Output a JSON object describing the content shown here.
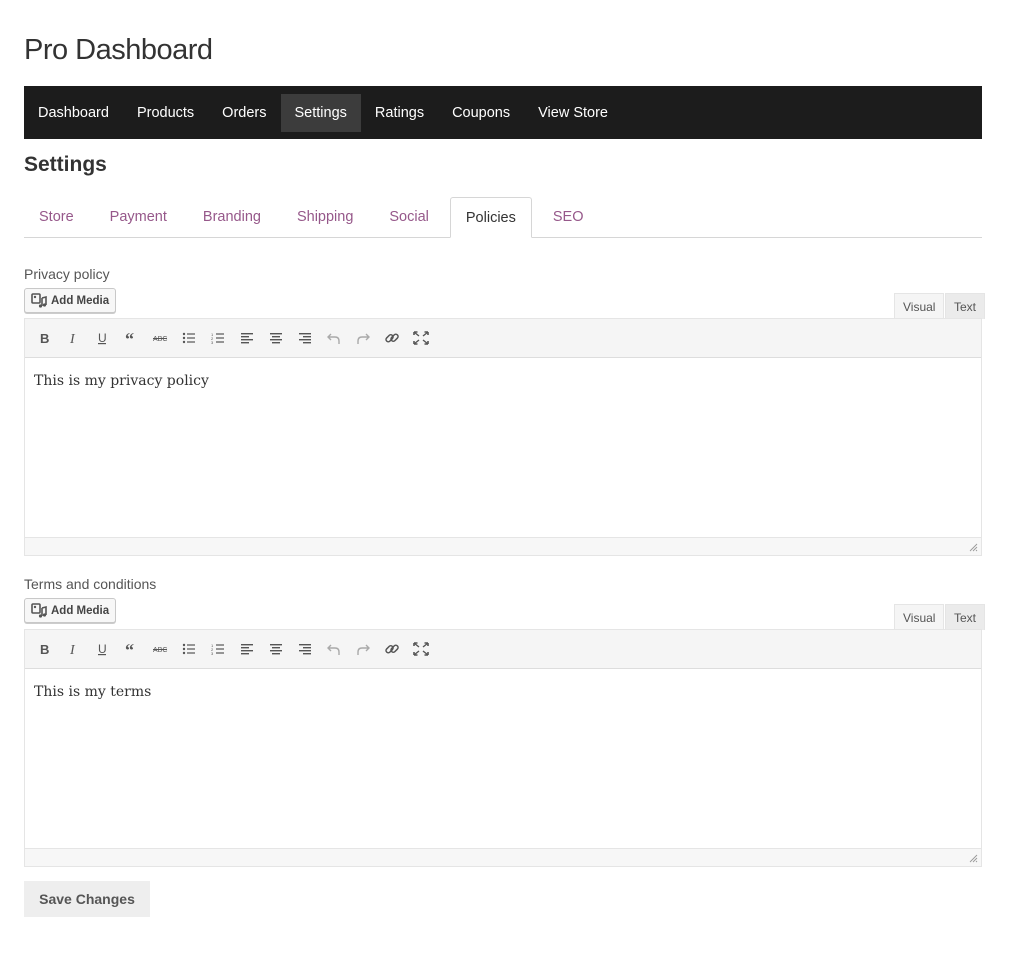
{
  "app": {
    "title": "Pro Dashboard"
  },
  "topnav": {
    "items": [
      {
        "label": "Dashboard"
      },
      {
        "label": "Products"
      },
      {
        "label": "Orders"
      },
      {
        "label": "Settings"
      },
      {
        "label": "Ratings"
      },
      {
        "label": "Coupons"
      },
      {
        "label": "View Store"
      }
    ],
    "active": "Settings"
  },
  "settings": {
    "title": "Settings",
    "tabs": [
      {
        "label": "Store"
      },
      {
        "label": "Payment"
      },
      {
        "label": "Branding"
      },
      {
        "label": "Shipping"
      },
      {
        "label": "Social"
      },
      {
        "label": "Policies"
      },
      {
        "label": "SEO"
      }
    ],
    "active_tab": "Policies"
  },
  "editor_common": {
    "add_media_label": "Add Media",
    "visual_label": "Visual",
    "text_label": "Text",
    "active_mode": "Visual",
    "toolbar_icons": [
      "bold-icon",
      "italic-icon",
      "underline-icon",
      "blockquote-icon",
      "strikethrough-icon",
      "bullet-list-icon",
      "numbered-list-icon",
      "align-left-icon",
      "align-center-icon",
      "align-right-icon",
      "undo-icon",
      "redo-icon",
      "link-icon",
      "fullscreen-icon"
    ]
  },
  "privacy": {
    "label": "Privacy policy",
    "content": "This is my privacy policy"
  },
  "terms": {
    "label": "Terms and conditions",
    "content": "This is my terms"
  },
  "actions": {
    "save_label": "Save Changes"
  },
  "colors": {
    "nav_bg": "#1c1c1c",
    "nav_active": "#3c3c3c",
    "tab_link": "#96588a"
  }
}
